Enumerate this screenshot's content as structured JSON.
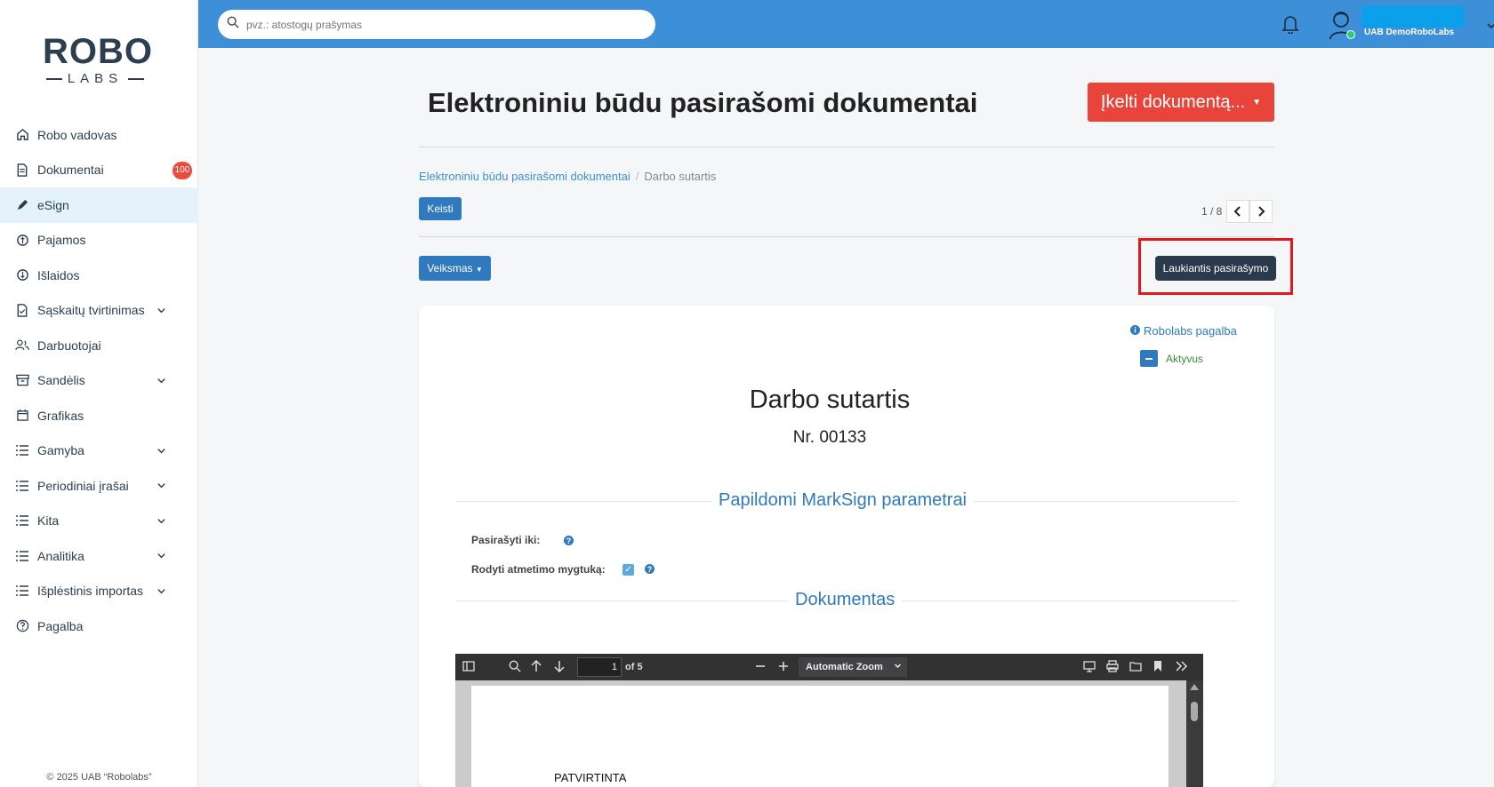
{
  "brand": {
    "top": "ROBO",
    "bottom": "LABS"
  },
  "search": {
    "placeholder": "pvz.: atostogų prašymas"
  },
  "header": {
    "company": "UAB DemoRoboLabs"
  },
  "sidebar": {
    "items": [
      {
        "label": "Robo vadovas",
        "icon": "home-icon"
      },
      {
        "label": "Dokumentai",
        "icon": "document-icon",
        "badge": "100"
      },
      {
        "label": "eSign",
        "icon": "pen-icon",
        "active": true
      },
      {
        "label": "Pajamos",
        "icon": "income-icon"
      },
      {
        "label": "Išlaidos",
        "icon": "expense-icon"
      },
      {
        "label": "Sąskaitų tvirtinimas",
        "icon": "invoice-check-icon",
        "expandable": true
      },
      {
        "label": "Darbuotojai",
        "icon": "users-icon"
      },
      {
        "label": "Sandėlis",
        "icon": "archive-icon",
        "expandable": true
      },
      {
        "label": "Grafikas",
        "icon": "calendar-icon"
      },
      {
        "label": "Gamyba",
        "icon": "list-icon",
        "expandable": true
      },
      {
        "label": "Periodiniai įrašai",
        "icon": "list-icon",
        "expandable": true
      },
      {
        "label": "Kita",
        "icon": "list-icon",
        "expandable": true
      },
      {
        "label": "Analitika",
        "icon": "list-icon",
        "expandable": true
      },
      {
        "label": "Išplėstinis importas",
        "icon": "list-icon",
        "expandable": true
      },
      {
        "label": "Pagalba",
        "icon": "help-circle-icon"
      }
    ],
    "copyright": "© 2025 UAB “Robolabs”"
  },
  "main": {
    "title": "Elektroniniu būdu pasirašomi dokumentai",
    "upload_button": "Įkelti dokumentą...",
    "breadcrumb": {
      "link": "Elektroniniu būdu pasirašomi dokumentai",
      "separator": "/",
      "current": "Darbo sutartis"
    },
    "edit_button": "Keisti",
    "pager": "1 / 8",
    "action_button": "Veiksmas",
    "status_button": "Laukiantis pasirašymo"
  },
  "card": {
    "help_link": "Robolabs pagalba",
    "state": "Aktyvus",
    "doc_title": "Darbo sutartis",
    "doc_number": "Nr. 00133",
    "section_marksign": "Papildomi MarkSign parametrai",
    "field_sign_until": "Pasirašyti iki:",
    "field_show_reject": "Rodyti atmetimo mygtuką:",
    "section_document": "Dokumentas"
  },
  "pdf_viewer": {
    "page": "1",
    "of_pages": "of 5",
    "zoom": "Automatic Zoom",
    "page_text": "PATVIRTINTA"
  },
  "colors": {
    "topbar": "#3d8fd8",
    "primary": "#2f79be",
    "upload": "#e8443a",
    "status": "#2b3a4b",
    "highlight": "#e3171c"
  }
}
